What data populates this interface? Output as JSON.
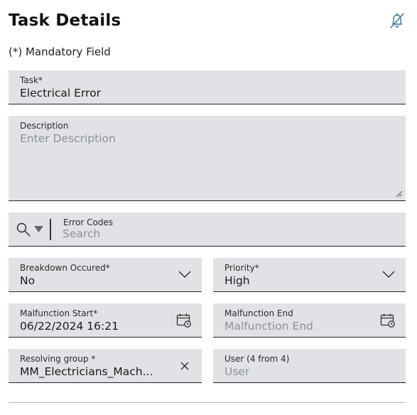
{
  "page": {
    "title": "Task Details",
    "mandatory_note": "(*) Mandatory Field",
    "header_icon": "bell-off-icon"
  },
  "form": {
    "task": {
      "label": "Task*",
      "value": "Electrical Error"
    },
    "description": {
      "label": "Description",
      "placeholder": "Enter Description",
      "value": ""
    },
    "error_codes": {
      "label": "Error Codes",
      "placeholder": "Search",
      "icon": "search-icon",
      "dropdown_icon": "caret-down-icon"
    },
    "breakdown": {
      "label": "Breakdown Occured*",
      "value": "No"
    },
    "priority": {
      "label": "Priority*",
      "value": "High"
    },
    "malfunction_start": {
      "label": "Malfunction Start*",
      "value": "06/22/2024 16:21"
    },
    "malfunction_end": {
      "label": "Malfunction End",
      "placeholder": "Malfunction End",
      "value": ""
    },
    "resolving_group": {
      "label": "Resolving group *",
      "value": "MM_Electricians_Mach..."
    },
    "user": {
      "label": "User (4 from 4)",
      "placeholder": "User",
      "value": ""
    }
  },
  "colors": {
    "field_bg": "#e0e2e5",
    "field_border": "#222222",
    "placeholder": "#8d9196",
    "icon": "#3a6f93"
  }
}
